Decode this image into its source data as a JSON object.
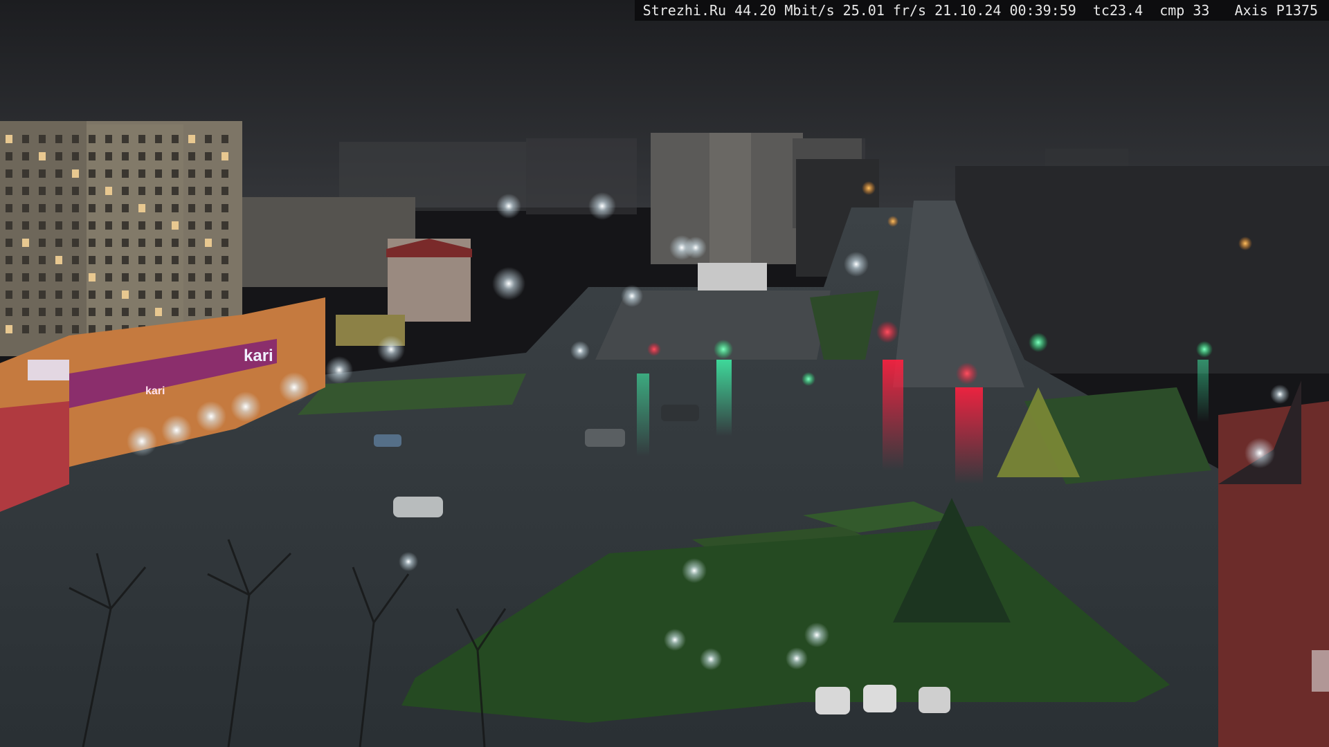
{
  "overlay": {
    "text": "Strezhi.Ru 44.20 Mbit/s 25.01 fr/s 21.10.24 00:39:59  tc23.4  cmp 33   Axis P1375"
  },
  "storefront": {
    "sign_main": "kari",
    "sign_small": "kari"
  },
  "colors": {
    "sky": "#202124",
    "asphalt": "#3d4346",
    "grass": "#2f5a2a",
    "building": "#8d806c",
    "store": "#c9783c",
    "store_sign": "#8a2d6a",
    "lamp": "#ffffff",
    "traffic_red": "#ff2030",
    "traffic_green": "#30ff90"
  }
}
